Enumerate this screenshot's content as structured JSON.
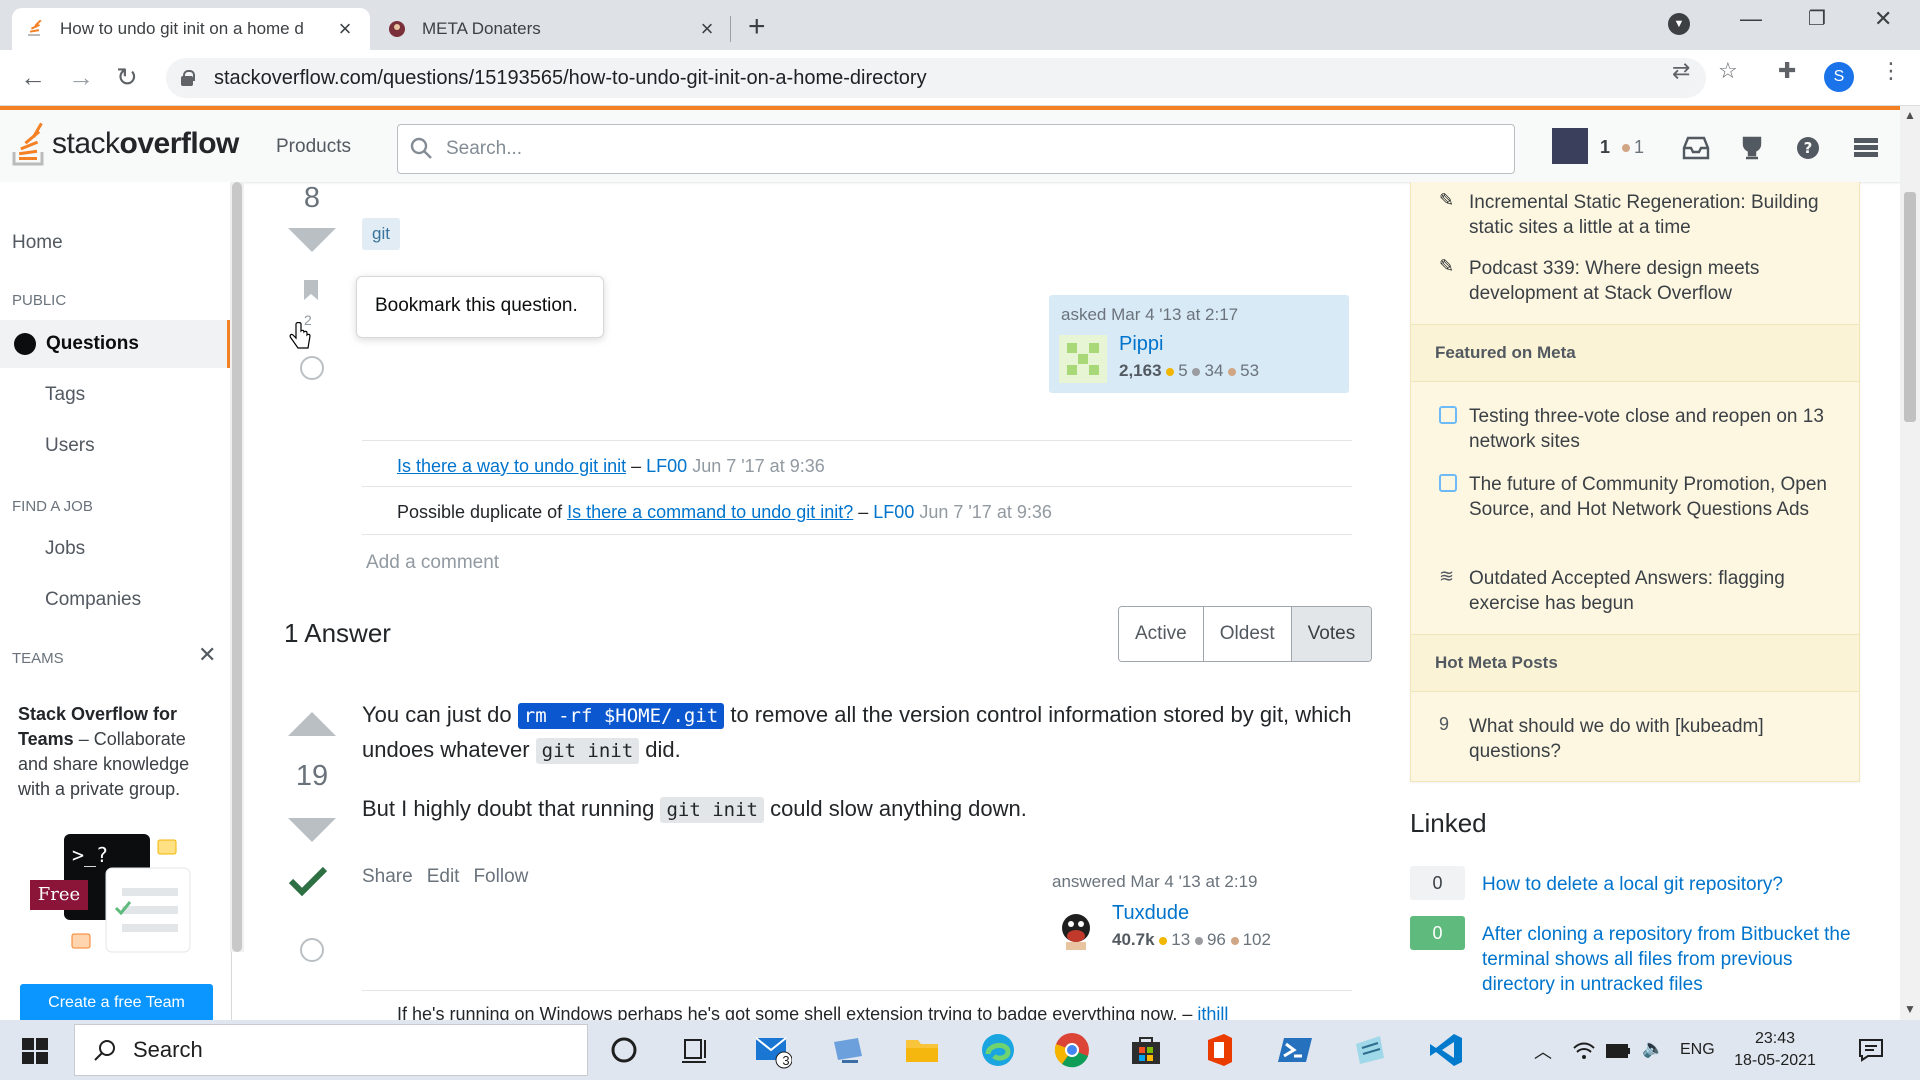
{
  "browser": {
    "tabs": [
      {
        "title": "How to undo git init on a home d",
        "active": true
      },
      {
        "title": "META Donaters",
        "active": false
      }
    ],
    "url": "stackoverflow.com/questions/15193565/how-to-undo-git-init-on-a-home-directory",
    "profile_initial": "S"
  },
  "topbar": {
    "logo_light": "stack",
    "logo_bold": "overflow",
    "products": "Products",
    "search_placeholder": "Search...",
    "rep": "1",
    "bronze": "1"
  },
  "leftnav": {
    "home": "Home",
    "public": "PUBLIC",
    "questions": "Questions",
    "tags": "Tags",
    "users": "Users",
    "find_job": "FIND A JOB",
    "jobs": "Jobs",
    "companies": "Companies",
    "teams": "TEAMS",
    "teams_title": "Stack Overflow for Teams",
    "teams_desc": " – Collaborate and share knowledge with a private group.",
    "free": "Free",
    "create_team": "Create a free Team"
  },
  "question": {
    "score": "8",
    "tag": "git",
    "tooltip": "Bookmark this question.",
    "bookmarks": "2",
    "asked": "asked Mar 4 '13 at 2:17",
    "owner": "Pippi",
    "owner_rep": "2,163",
    "owner_gold": "5",
    "owner_silver": "34",
    "owner_bronze": "53",
    "comments": [
      {
        "link": "Is there a way to undo git init",
        "prefix": "",
        "sep": " – ",
        "user": "LF00",
        "time": " Jun 7 '17 at 9:36"
      },
      {
        "link": "Is there a command to undo git init?",
        "prefix": "Possible duplicate of ",
        "sep": " – ",
        "user": "LF00",
        "time": " Jun 7 '17 at 9:36"
      }
    ],
    "add_comment": "Add a comment"
  },
  "answers": {
    "heading": "1 Answer",
    "sort": [
      "Active",
      "Oldest",
      "Votes"
    ],
    "score": "19",
    "p1_a": "You can just do ",
    "p1_code": "rm -rf $HOME/.git",
    "p1_b": " to remove all the version control information stored by git, which undoes whatever ",
    "p1_code2": "git init",
    "p1_c": " did.",
    "p2_a": "But I highly doubt that running ",
    "p2_code": "git init",
    "p2_b": " could slow anything down.",
    "menu": [
      "Share",
      "Edit",
      "Follow"
    ],
    "answered": "answered Mar 4 '13 at 2:19",
    "user": "Tuxdude",
    "user_rep": "40.7k",
    "user_gold": "13",
    "user_silver": "96",
    "user_bronze": "102",
    "comment_partial": "If he's running on Windows perhaps he's got some shell extension trying to badge everything now. –",
    "comment_user": "ithill"
  },
  "sidebar": {
    "blog": [
      "Incremental Static Regeneration: Building static sites a little at a time",
      "Podcast 339: Where design meets development at Stack Overflow"
    ],
    "featured_head": "Featured on Meta",
    "featured": [
      "Testing three-vote close and reopen on 13 network sites",
      "The future of Community Promotion, Open Source, and Hot Network Questions Ads",
      "Outdated Accepted Answers: flagging exercise has begun"
    ],
    "hot_head": "Hot Meta Posts",
    "hot": [
      {
        "score": "9",
        "title": "What should we do with [kubeadm] questions?"
      }
    ],
    "linked_head": "Linked",
    "linked": [
      {
        "score": "0",
        "title": "How to delete a local git repository?",
        "accepted": false
      },
      {
        "score": "0",
        "title": "After cloning a repository from Bitbucket the terminal shows all files from previous directory in untracked files",
        "accepted": true
      }
    ]
  },
  "taskbar": {
    "search": "Search",
    "mail_badge": "3",
    "lang": "ENG",
    "time": "23:43",
    "date": "18-05-2021"
  }
}
